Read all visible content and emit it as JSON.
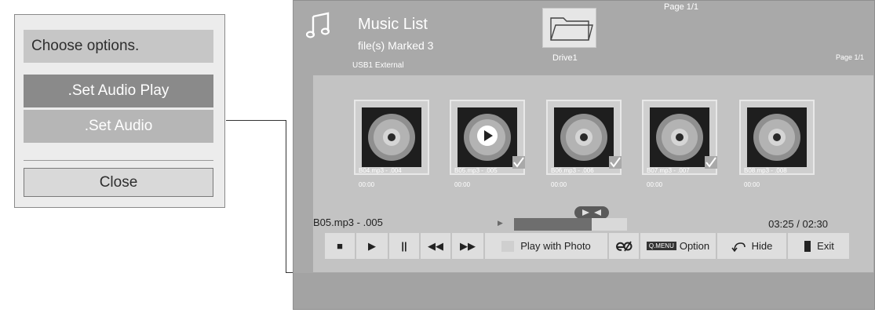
{
  "popup": {
    "title": "Choose options.",
    "options": [
      {
        "label": ".Set Audio Play",
        "selected": true
      },
      {
        "label": ".Set Audio",
        "selected": false
      }
    ],
    "close_label": "Close"
  },
  "header": {
    "icon": "music-note-icon",
    "title": "Music List",
    "marked": "file(s) Marked 3",
    "device": "USB1 External",
    "folder_icon": "folder-icon",
    "drive": "Drive1",
    "page_top": "Page 1/1",
    "page_right": "Page 1/1"
  },
  "files": [
    {
      "name": "B04.mp3 - .004",
      "duration": "00:00",
      "checked": false,
      "playing": false
    },
    {
      "name": "B05.mp3 - .005",
      "duration": "00:00",
      "checked": true,
      "playing": true
    },
    {
      "name": "B06.mp3 - .006",
      "duration": "00:00",
      "checked": true,
      "playing": false
    },
    {
      "name": "B07.mp3 - .007",
      "duration": "00:00",
      "checked": true,
      "playing": false
    },
    {
      "name": "B08.mp3 - .008",
      "duration": "00:00",
      "checked": false,
      "playing": false
    }
  ],
  "now_playing": {
    "title": "B05.mp3 - .005",
    "time": "03:25 / 02:30",
    "progress_fraction": 0.69
  },
  "controls": {
    "stop": "■",
    "play": "▶",
    "pause": "||",
    "rewind": "◀◀",
    "forward": "▶▶",
    "play_with_photo": "Play with Photo",
    "energy_icon": "energy-saving-icon",
    "qmenu_tag": "Q.MENU",
    "option": "Option",
    "hide": "Hide",
    "exit": "Exit"
  },
  "colors": {
    "screen_bg": "#a9a9a9",
    "content_bg": "#c3c3c3",
    "selected_option": "#8a8a8a"
  }
}
